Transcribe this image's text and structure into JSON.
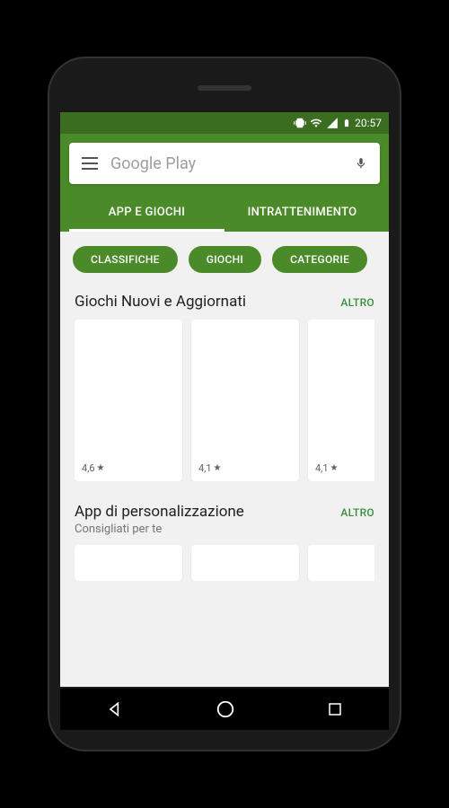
{
  "status": {
    "time": "20:57"
  },
  "search": {
    "placeholder": "Google Play"
  },
  "tabs": [
    {
      "label": "APP E GIOCHI",
      "active": true
    },
    {
      "label": "INTRATTENIMENTO",
      "active": false
    }
  ],
  "chips": [
    {
      "label": "CLASSIFICHE"
    },
    {
      "label": "GIOCHI"
    },
    {
      "label": "CATEGORIE"
    }
  ],
  "sections": [
    {
      "title": "Giochi Nuovi e Aggiornati",
      "subtitle": "",
      "more": "ALTRO",
      "cards": [
        {
          "rating": "4,6"
        },
        {
          "rating": "4,1"
        },
        {
          "rating": "4,1"
        }
      ]
    },
    {
      "title": "App di personalizzazione",
      "subtitle": "Consigliati per te",
      "more": "ALTRO",
      "cards": [
        {
          "rating": ""
        },
        {
          "rating": ""
        },
        {
          "rating": ""
        }
      ]
    }
  ]
}
